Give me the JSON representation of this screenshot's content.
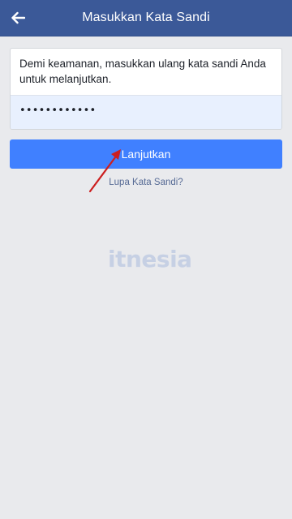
{
  "header": {
    "title": "Masukkan Kata Sandi",
    "back_icon": "arrow-left-icon"
  },
  "form": {
    "message": "Demi keamanan, masukkan ulang kata sandi Anda untuk melanjutkan.",
    "password_value": "••••••••••••",
    "continue_label": "Lanjutkan",
    "forgot_label": "Lupa Kata Sandi?"
  },
  "annotation": {
    "arrow_color": "#cc1f1f"
  },
  "watermark": {
    "text": "itnesia"
  },
  "colors": {
    "header_bg": "#3b5998",
    "button_bg": "#4080ff",
    "page_bg": "#e9eaed",
    "field_bg": "#e8f0fe"
  }
}
